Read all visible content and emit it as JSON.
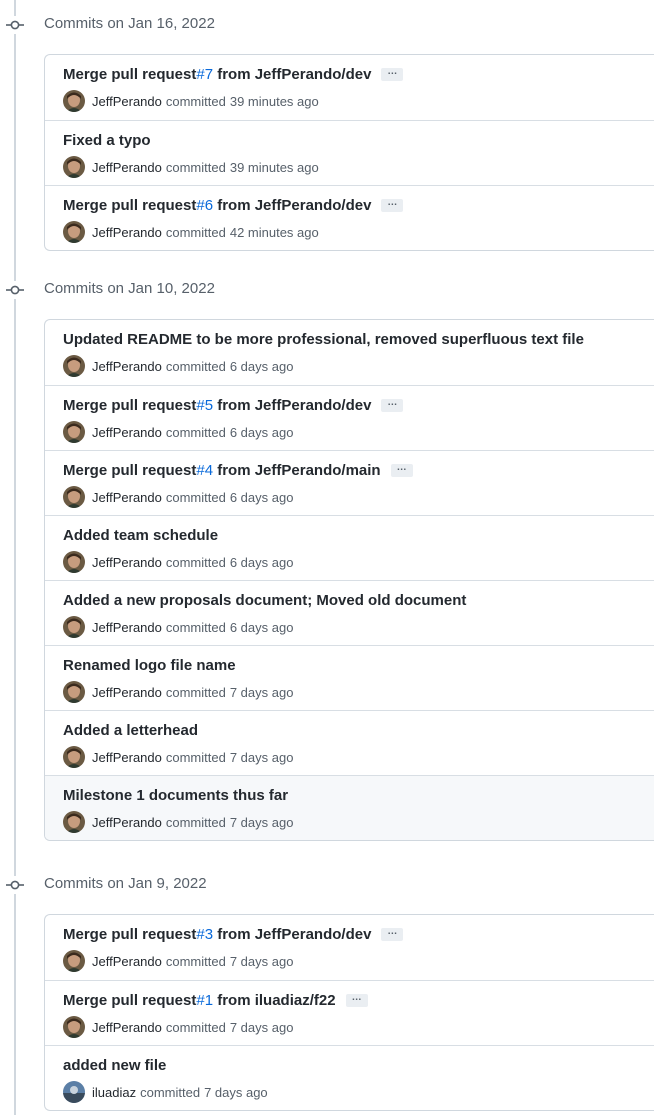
{
  "groups": [
    {
      "title": "Commits on Jan 16, 2022",
      "commits": [
        {
          "pre": "Merge pull request ",
          "pr": "#7",
          "post": " from JeffPerando/dev",
          "more": "…",
          "author": "JeffPerando",
          "verb": "committed",
          "time": "39 minutes ago"
        },
        {
          "pre": "Fixed a typo",
          "pr": "",
          "post": "",
          "more": "",
          "author": "JeffPerando",
          "verb": "committed",
          "time": "39 minutes ago"
        },
        {
          "pre": "Merge pull request ",
          "pr": "#6",
          "post": " from JeffPerando/dev",
          "more": "…",
          "author": "JeffPerando",
          "verb": "committed",
          "time": "42 minutes ago"
        }
      ]
    },
    {
      "title": "Commits on Jan 10, 2022",
      "commits": [
        {
          "pre": "Updated README to be more professional, removed superfluous text file",
          "pr": "",
          "post": "",
          "more": "",
          "author": "JeffPerando",
          "verb": "committed",
          "time": "6 days ago"
        },
        {
          "pre": "Merge pull request ",
          "pr": "#5",
          "post": " from JeffPerando/dev",
          "more": "…",
          "author": "JeffPerando",
          "verb": "committed",
          "time": "6 days ago"
        },
        {
          "pre": "Merge pull request ",
          "pr": "#4",
          "post": " from JeffPerando/main",
          "more": "…",
          "author": "JeffPerando",
          "verb": "committed",
          "time": "6 days ago"
        },
        {
          "pre": "Added team schedule",
          "pr": "",
          "post": "",
          "more": "",
          "author": "JeffPerando",
          "verb": "committed",
          "time": "6 days ago"
        },
        {
          "pre": "Added a new proposals document; Moved old document",
          "pr": "",
          "post": "",
          "more": "",
          "author": "JeffPerando",
          "verb": "committed",
          "time": "6 days ago"
        },
        {
          "pre": "Renamed logo file name",
          "pr": "",
          "post": "",
          "more": "",
          "author": "JeffPerando",
          "verb": "committed",
          "time": "7 days ago"
        },
        {
          "pre": "Added a letterhead",
          "pr": "",
          "post": "",
          "more": "",
          "author": "JeffPerando",
          "verb": "committed",
          "time": "7 days ago"
        },
        {
          "pre": "Milestone 1 documents thus far",
          "pr": "",
          "post": "",
          "more": "",
          "author": "JeffPerando",
          "verb": "committed",
          "time": "7 days ago",
          "hover": true
        }
      ]
    },
    {
      "title": "Commits on Jan 9, 2022",
      "commits": [
        {
          "pre": "Merge pull request ",
          "pr": "#3",
          "post": " from JeffPerando/dev",
          "more": "…",
          "author": "JeffPerando",
          "verb": "committed",
          "time": "7 days ago"
        },
        {
          "pre": "Merge pull request ",
          "pr": "#1",
          "post": " from iluadiaz/f22",
          "more": "…",
          "author": "JeffPerando",
          "verb": "committed",
          "time": "7 days ago"
        },
        {
          "pre": "added new file",
          "pr": "",
          "post": "",
          "more": "",
          "author": "iluadiaz",
          "verb": "committed",
          "time": "7 days ago",
          "avatar": "alt"
        }
      ]
    }
  ]
}
